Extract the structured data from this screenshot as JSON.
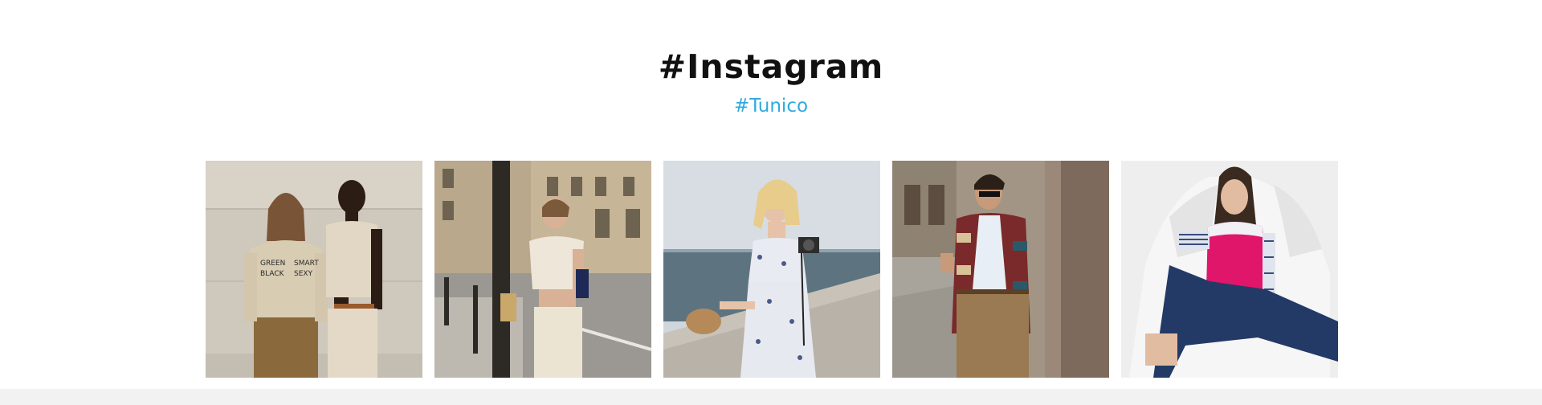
{
  "section": {
    "title": "#Instagram",
    "hashtag": "#Tunico"
  },
  "colors": {
    "title": "#111111",
    "hashtag": "#2fa9e0",
    "footer_strip": "#f2f2f2"
  },
  "posts": [
    {
      "name": "instagram-post-1",
      "shirt_text": [
        "GREEN",
        "BLACK",
        "SMART",
        "SEXY"
      ]
    },
    {
      "name": "instagram-post-2"
    },
    {
      "name": "instagram-post-3"
    },
    {
      "name": "instagram-post-4"
    },
    {
      "name": "instagram-post-5"
    }
  ]
}
